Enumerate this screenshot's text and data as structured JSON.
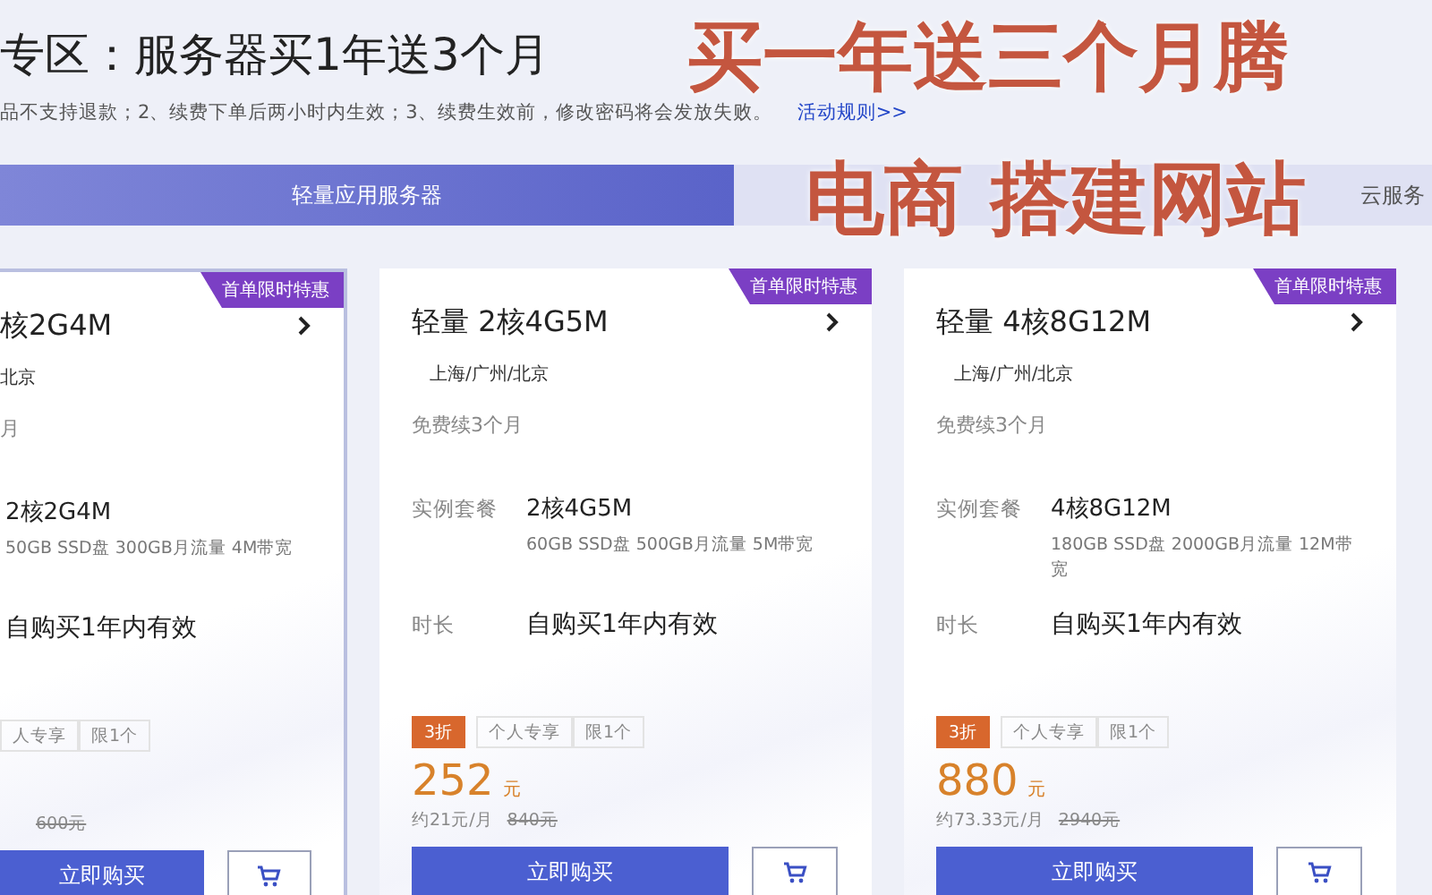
{
  "header": {
    "title": "专区：服务器买1年送3个月",
    "notice": "品不支持退款；2、续费下单后两小时内生效；3、续费生效前，修改密码将会发放失败。",
    "rules_link": "活动规则>>"
  },
  "tabs": [
    {
      "label": "轻量应用服务器",
      "selected": true
    },
    {
      "label": "云服务",
      "selected": false
    }
  ],
  "cards": [
    {
      "selected": true,
      "badge": "首单限时特惠",
      "title": "核2G4M",
      "region": "北京",
      "renew": "月",
      "spec": "2核2G4M",
      "spec_desc": "50GB SSD盘 300GB月流量 4M带宽",
      "duration": "自购买1年内有效",
      "tags": [
        {
          "label": "人专享",
          "kind": "plain"
        },
        {
          "label": "限1个",
          "kind": "plain"
        }
      ],
      "original": "600元",
      "buy_label": "立即购买"
    },
    {
      "selected": false,
      "badge": "首单限时特惠",
      "title": "轻量 2核4G5M",
      "region": "上海/广州/北京",
      "renew": "免费续3个月",
      "spec_label": "实例套餐",
      "spec": "2核4G5M",
      "spec_desc": "60GB SSD盘 500GB月流量 5M带宽",
      "duration_label": "时长",
      "duration": "自购买1年内有效",
      "tags": [
        {
          "label": "3折",
          "kind": "discount"
        },
        {
          "label": "个人专享",
          "kind": "plain"
        },
        {
          "label": "限1个",
          "kind": "plain"
        }
      ],
      "price": "252",
      "unit": "元",
      "monthly": "约21元/月",
      "original": "840元",
      "buy_label": "立即购买"
    },
    {
      "selected": false,
      "badge": "首单限时特惠",
      "title": "轻量 4核8G12M",
      "region": "上海/广州/北京",
      "renew": "免费续3个月",
      "spec_label": "实例套餐",
      "spec": "4核8G12M",
      "spec_desc": "180GB SSD盘 2000GB月流量 12M带宽",
      "duration_label": "时长",
      "duration": "自购买1年内有效",
      "tags": [
        {
          "label": "3折",
          "kind": "discount"
        },
        {
          "label": "个人专享",
          "kind": "plain"
        },
        {
          "label": "限1个",
          "kind": "plain"
        }
      ],
      "price": "880",
      "unit": "元",
      "monthly": "约73.33元/月",
      "original": "2940元",
      "buy_label": "立即购买"
    }
  ],
  "captions": [
    "买一年送三个月腾",
    "电商 搭建网站"
  ]
}
